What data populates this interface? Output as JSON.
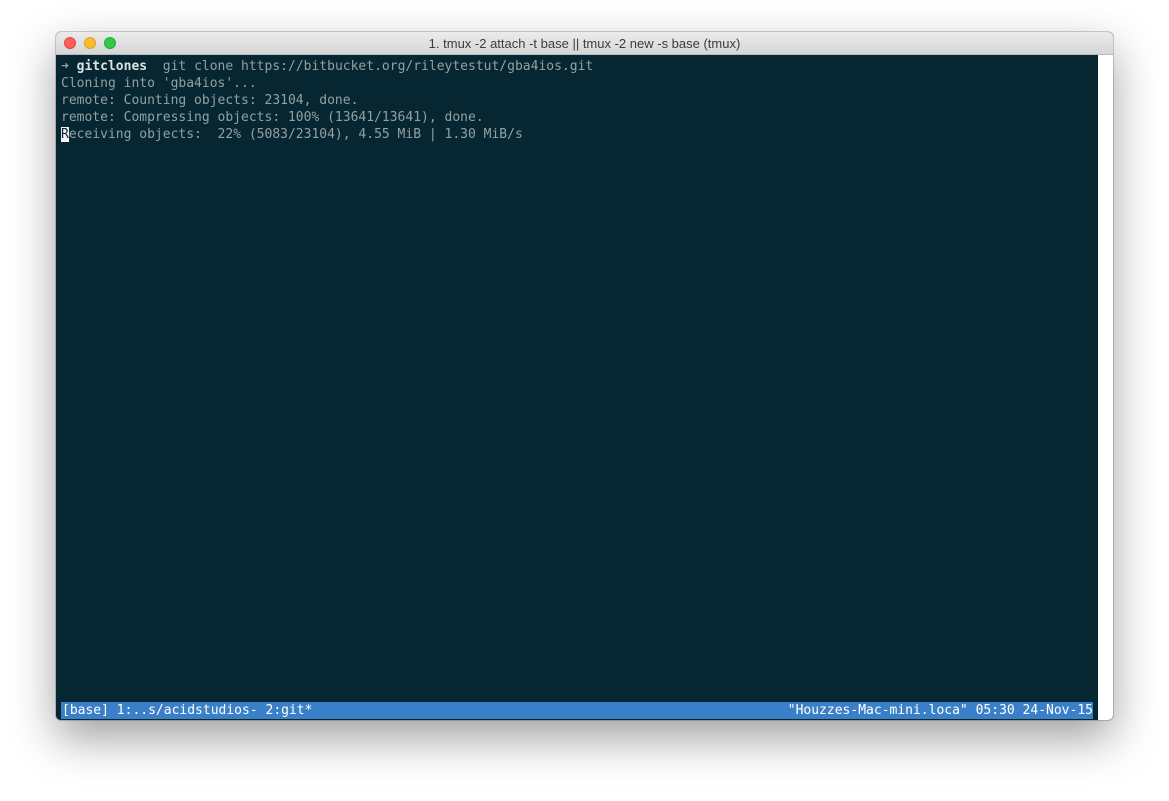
{
  "window": {
    "title": "1. tmux -2 attach -t base || tmux -2 new -s base (tmux)"
  },
  "terminal": {
    "prompt_arrow": "➜",
    "prompt_dir": "gitclones",
    "command": "git clone https://bitbucket.org/rileytestut/gba4ios.git",
    "output": [
      "Cloning into 'gba4ios'...",
      "remote: Counting objects: 23104, done.",
      "remote: Compressing objects: 100% (13641/13641), done."
    ],
    "progress_cursor_char": "R",
    "progress_rest": "eceiving objects:  22% (5083/23104), 4.55 MiB | 1.30 MiB/s",
    "progress_percent": 22
  },
  "status_bar": {
    "left": "[base] 1:..s/acidstudios- 2:git*",
    "right": "\"Houzzes-Mac-mini.loca\" 05:30 24-Nov-15",
    "background_color": "#3a80c9"
  },
  "colors": {
    "terminal_background": "#062631",
    "terminal_text": "#93a1a1"
  }
}
